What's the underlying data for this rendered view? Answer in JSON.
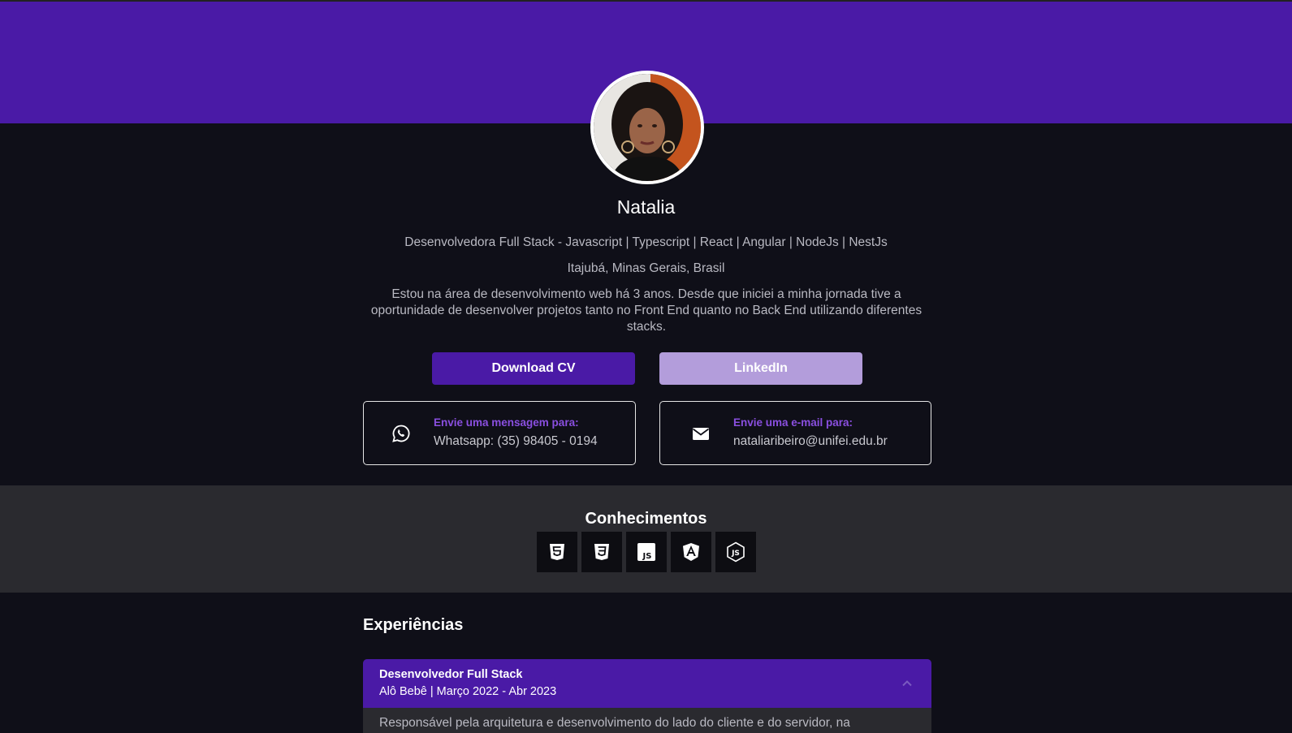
{
  "profile": {
    "name": "Natalia",
    "role": "Desenvolvedora Full Stack - Javascript | Typescript | React | Angular | NodeJs | NestJs",
    "location": "Itajubá, Minas Gerais, Brasil",
    "bio": "Estou na área de desenvolvimento web há 3 anos. Desde que iniciei a minha jornada tive a oportunidade de desenvolver projetos tanto no Front End quanto no Back End utilizando diferentes stacks."
  },
  "buttons": {
    "download_cv": "Download CV",
    "linkedin": "LinkedIn"
  },
  "contacts": {
    "whatsapp": {
      "label": "Envie uma mensagem para:",
      "value": "Whatsapp: (35) 98405 - 0194",
      "icon": "whatsapp-icon"
    },
    "email": {
      "label": "Envie uma e-mail para:",
      "value": "nataliaribeiro@unifei.edu.br",
      "icon": "envelope-icon"
    }
  },
  "skills": {
    "title": "Conhecimentos",
    "items": [
      {
        "icon": "html5-icon"
      },
      {
        "icon": "css3-icon"
      },
      {
        "icon": "javascript-icon"
      },
      {
        "icon": "angular-icon"
      },
      {
        "icon": "nodejs-icon"
      }
    ]
  },
  "experience": {
    "title": "Experiências",
    "items": [
      {
        "role": "Desenvolvedor Full Stack",
        "meta": "Alô Bebê | Março 2022 - Abr 2023",
        "description": "Responsável pela arquitetura e desenvolvimento do lado do cliente e do servidor, na"
      }
    ]
  },
  "colors": {
    "primary": "#4a1aa6",
    "secondary": "#b39ddb",
    "accent_text": "#8a4fe0",
    "background": "#0f0f18",
    "section_background": "#2a2a2f"
  }
}
